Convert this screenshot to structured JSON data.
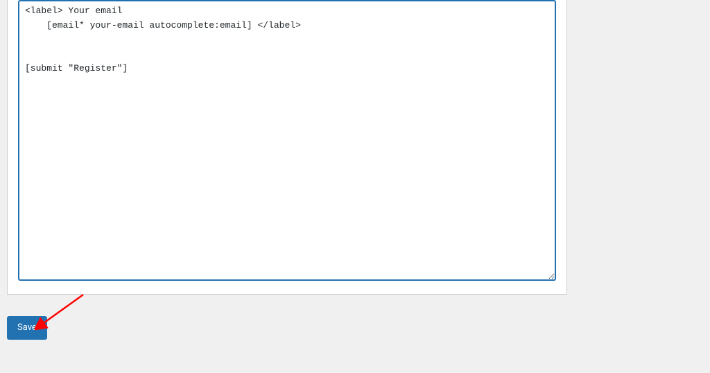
{
  "form": {
    "textarea_value": "<label> Your email\n    [email* your-email autocomplete:email] </label>\n\n\n[submit \"Register\"]"
  },
  "actions": {
    "save_label": "Save"
  },
  "annotation": {
    "arrow_color": "#ff0000"
  }
}
